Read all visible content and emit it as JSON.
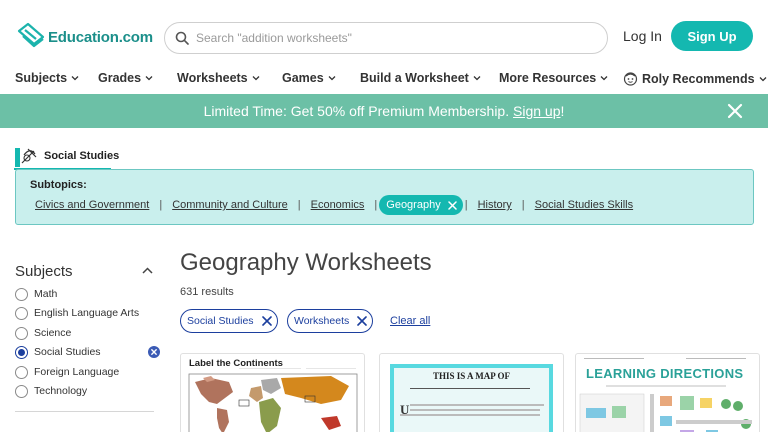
{
  "header": {
    "logo_text": "Education.com",
    "search_placeholder": "Search \"addition worksheets\"",
    "login_label": "Log In",
    "signup_label": "Sign Up"
  },
  "nav": {
    "items": [
      {
        "label": "Subjects"
      },
      {
        "label": "Grades"
      },
      {
        "label": "Worksheets"
      },
      {
        "label": "Games"
      },
      {
        "label": "Build a Worksheet"
      },
      {
        "label": "More Resources"
      },
      {
        "label": "Roly Recommends"
      }
    ]
  },
  "banner": {
    "text": "Limited Time: Get 50% off Premium Membership.",
    "link_label": "Sign up",
    "suffix": "!"
  },
  "subject_tab": {
    "label": "Social Studies"
  },
  "subtopics": {
    "label": "Subtopics:",
    "items": [
      {
        "label": "Civics and Government"
      },
      {
        "label": "Community and Culture"
      },
      {
        "label": "Economics"
      },
      {
        "label": "Geography"
      },
      {
        "label": "History"
      },
      {
        "label": "Social Studies Skills"
      }
    ]
  },
  "sidebar": {
    "title": "Subjects",
    "filters": [
      {
        "label": "Math"
      },
      {
        "label": "English Language Arts"
      },
      {
        "label": "Science"
      },
      {
        "label": "Social Studies"
      },
      {
        "label": "Foreign Language"
      },
      {
        "label": "Technology"
      }
    ]
  },
  "main": {
    "title": "Geography Worksheets",
    "results": "631 results",
    "active_filters": [
      {
        "label": "Social Studies"
      },
      {
        "label": "Worksheets"
      }
    ],
    "clear_all": "Clear all",
    "cards": [
      {
        "title": "Label the Continents"
      },
      {
        "title": "THIS IS A MAP OF"
      },
      {
        "title": "LEARNING DIRECTIONS"
      }
    ]
  },
  "colors": {
    "teal": "#14b8b0",
    "banner_green": "#6cc0a6",
    "navy": "#1c3f9e",
    "subtopic_bg": "#c9efed"
  }
}
